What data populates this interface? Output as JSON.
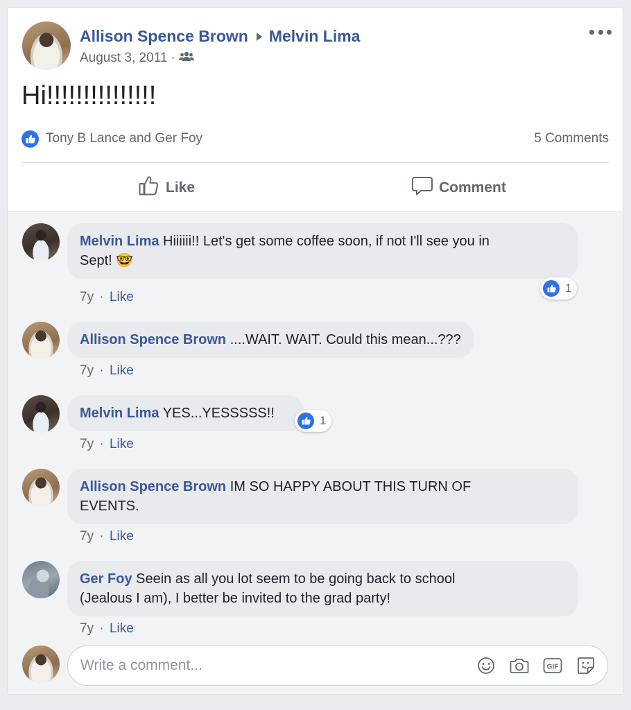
{
  "post": {
    "author": "Allison Spence Brown",
    "recipient": "Melvin Lima",
    "date": "August 3, 2011",
    "date_separator": "·",
    "audience_icon": "friends-icon",
    "text": "Hi!!!!!!!!!!!!!!!",
    "likes_text": "Tony B Lance and Ger Foy",
    "comments_count": "5 Comments"
  },
  "actions": {
    "like_label": "Like",
    "comment_label": "Comment"
  },
  "comments": [
    {
      "author": "Melvin Lima",
      "text": "Hiiiiii!! Let's get some coffee soon, if not I'll see you in",
      "text_line2": "Sept! ",
      "emoji": "🤓",
      "age": "7y",
      "sep": "·",
      "like": "Like",
      "reaction_count": "1"
    },
    {
      "author": "Allison Spence Brown",
      "text": "....WAIT. WAIT. Could this mean...???",
      "age": "7y",
      "sep": "·",
      "like": "Like"
    },
    {
      "author": "Melvin Lima",
      "text": "YES...YESSSSS!!",
      "age": "7y",
      "sep": "·",
      "like": "Like",
      "reaction_count": "1"
    },
    {
      "author": "Allison Spence Brown",
      "text": "IM SO HAPPY ABOUT THIS TURN OF",
      "text_line2": "EVENTS.",
      "age": "7y",
      "sep": "·",
      "like": "Like"
    },
    {
      "author": "Ger Foy",
      "text": "Seein as all you lot seem to be going back to school",
      "text_line2": "(Jealous I am), I better be invited to the grad party!",
      "age": "7y",
      "sep": "·",
      "like": "Like"
    }
  ],
  "composer": {
    "placeholder": "Write a comment...",
    "icons": [
      "emoji-icon",
      "camera-icon",
      "gif-icon",
      "sticker-icon"
    ]
  },
  "colors": {
    "link": "#385898",
    "like_blue": "#2f71ea",
    "bubble": "#e9eaed",
    "background": "#e9ebee"
  }
}
